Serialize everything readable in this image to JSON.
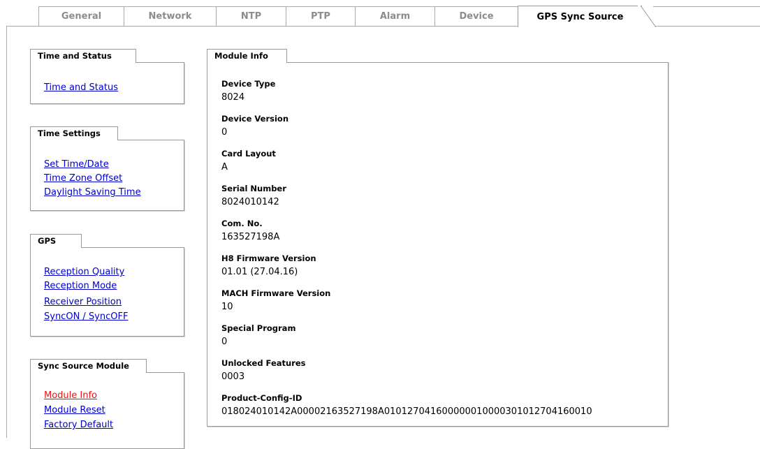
{
  "tabs": [
    {
      "label": "General"
    },
    {
      "label": "Network"
    },
    {
      "label": "NTP"
    },
    {
      "label": "PTP"
    },
    {
      "label": "Alarm"
    },
    {
      "label": "Device"
    },
    {
      "label": "GPS Sync Source"
    }
  ],
  "sidebar": {
    "time_status": {
      "title": "Time and Status",
      "links": [
        "Time and Status"
      ]
    },
    "time_settings": {
      "title": "Time Settings",
      "links": [
        "Set Time/Date",
        "Time Zone Offset",
        "Daylight Saving Time"
      ]
    },
    "gps": {
      "title": "GPS",
      "links": [
        "Reception Quality",
        "Reception Mode",
        "Receiver Position",
        "SyncON / SyncOFF"
      ]
    },
    "sync_source": {
      "title": "Sync Source Module",
      "links": [
        "Module Info",
        "Module Reset",
        "Factory Default"
      ]
    }
  },
  "module_info": {
    "title": "Module Info",
    "fields": [
      {
        "label": "Device Type",
        "value": "8024"
      },
      {
        "label": "Device Version",
        "value": "0"
      },
      {
        "label": "Card Layout",
        "value": "A"
      },
      {
        "label": "Serial Number",
        "value": "8024010142"
      },
      {
        "label": "Com. No.",
        "value": "163527198A"
      },
      {
        "label": "H8 Firmware Version",
        "value": "01.01 (27.04.16)"
      },
      {
        "label": "MACH Firmware Version",
        "value": "10"
      },
      {
        "label": "Special Program",
        "value": "0"
      },
      {
        "label": "Unlocked Features",
        "value": "0003"
      },
      {
        "label": "Product-Config-ID",
        "value": "018024010142A00002163527198A010127041600000010000301012704160010"
      }
    ]
  },
  "colors": {
    "link": "#0000cc",
    "active_link": "#ee1111",
    "border": "#9a9a9a",
    "inactive_tab_text": "#8c8c8c"
  }
}
